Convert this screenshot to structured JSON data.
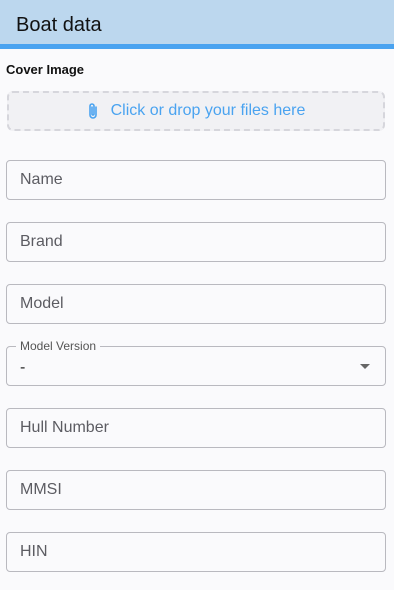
{
  "header": {
    "title": "Boat data"
  },
  "cover_image": {
    "label": "Cover Image",
    "dropzone_text": "Click or drop your files here",
    "icon": "paperclip-icon"
  },
  "fields": {
    "name": {
      "placeholder": "Name",
      "value": ""
    },
    "brand": {
      "placeholder": "Brand",
      "value": ""
    },
    "model": {
      "placeholder": "Model",
      "value": ""
    },
    "model_version": {
      "label": "Model Version",
      "selected": "-"
    },
    "hull_number": {
      "placeholder": "Hull Number",
      "value": ""
    },
    "mmsi": {
      "placeholder": "MMSI",
      "value": ""
    },
    "hin": {
      "placeholder": "HIN",
      "value": ""
    }
  },
  "colors": {
    "header_bg": "#bcd7ee",
    "accent": "#4aa3f0"
  }
}
